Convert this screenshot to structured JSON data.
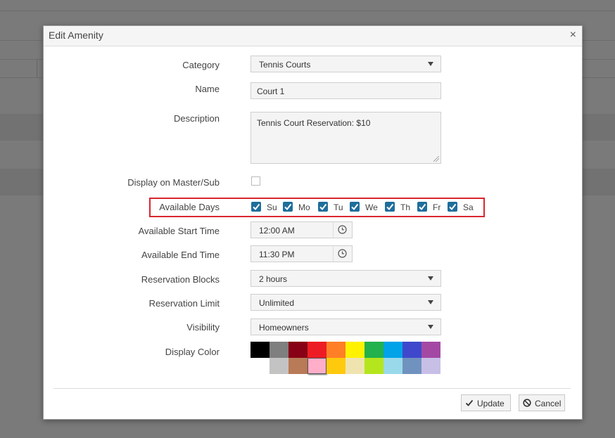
{
  "dialog": {
    "title": "Edit Amenity",
    "close_glyph": "×"
  },
  "form": {
    "category": {
      "label": "Category",
      "value": "Tennis Courts"
    },
    "name": {
      "label": "Name",
      "value": "Court 1"
    },
    "description": {
      "label": "Description",
      "value": "Tennis Court Reservation: $10"
    },
    "display_master": {
      "label": "Display on Master/Sub",
      "checked": false
    },
    "available_days": {
      "label": "Available Days",
      "days": [
        {
          "label": "Su",
          "checked": true
        },
        {
          "label": "Mo",
          "checked": true
        },
        {
          "label": "Tu",
          "checked": true
        },
        {
          "label": "We",
          "checked": true
        },
        {
          "label": "Th",
          "checked": true
        },
        {
          "label": "Fr",
          "checked": true
        },
        {
          "label": "Sa",
          "checked": true
        }
      ]
    },
    "start_time": {
      "label": "Available Start Time",
      "value": "12:00 AM"
    },
    "end_time": {
      "label": "Available End Time",
      "value": "11:30 PM"
    },
    "reservation_blocks": {
      "label": "Reservation Blocks",
      "value": "2 hours"
    },
    "reservation_limit": {
      "label": "Reservation Limit",
      "value": "Unlimited"
    },
    "visibility": {
      "label": "Visibility",
      "value": "Homeowners"
    },
    "display_color": {
      "label": "Display Color",
      "row1": [
        "#000000",
        "#7f7f7f",
        "#880015",
        "#ed1c24",
        "#ff7f27",
        "#fff200",
        "#22b14c",
        "#00a2e8",
        "#3f48cc",
        "#a349a4"
      ],
      "row2": [
        "#c3c3c3",
        "#b97a57",
        "#ffaec9",
        "#ffc90e",
        "#efe4b0",
        "#b5e61d",
        "#99d9ea",
        "#7092be",
        "#c8bfe7"
      ],
      "selected": "#ffaec9"
    }
  },
  "buttons": {
    "update": "Update",
    "cancel": "Cancel"
  },
  "colors": {
    "accent": "#1f6e9c",
    "highlight": "#d9262f"
  }
}
